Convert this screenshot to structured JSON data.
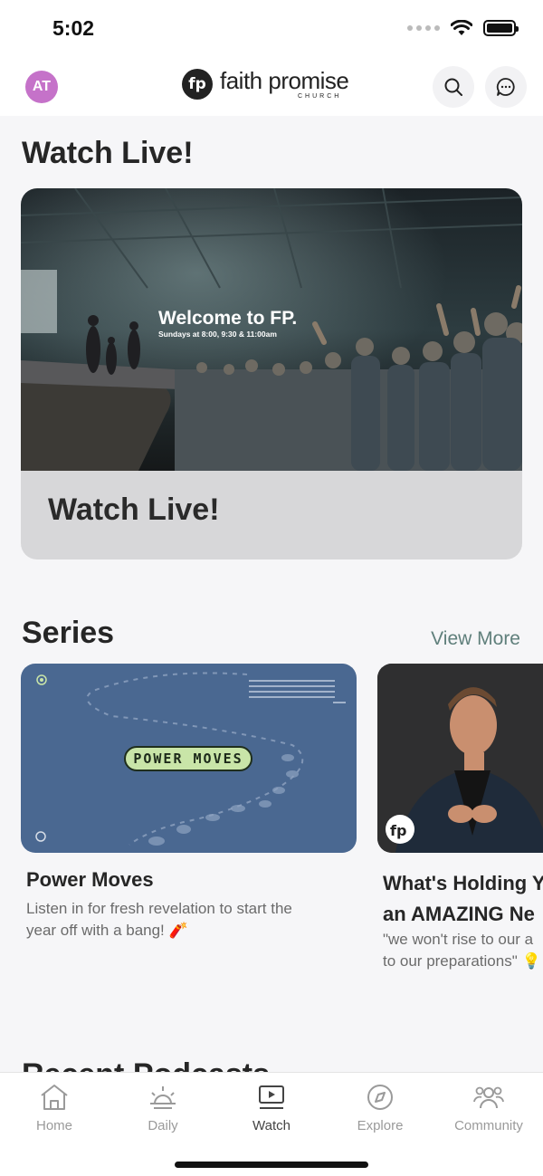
{
  "status_bar": {
    "time": "5:02"
  },
  "header": {
    "avatar_initials": "AT",
    "logo_mark": "fp",
    "logo_name": "faith promise",
    "logo_sub": "CHURCH"
  },
  "watch_live": {
    "section_title": "Watch Live!",
    "card_label": "Watch Live!",
    "image_headline": "Welcome to FP.",
    "image_subline": "Sundays at 8:00, 9:30 & 11:00am"
  },
  "series": {
    "section_title": "Series",
    "view_more_label": "View More",
    "items": [
      {
        "title": "Power Moves",
        "badge": "POWER MOVES",
        "description_line1": "Listen in for fresh revelation to start the",
        "description_line2": "year off with a bang! 🧨"
      },
      {
        "title_line1": "What's Holding Y",
        "title_line2": "an AMAZING Ne",
        "description_line1": "\"we won't rise to our a",
        "description_line2": "to our preparations\" 💡",
        "logo_mark": "fp"
      }
    ]
  },
  "next_section_peek": "Recent Podcasts",
  "tabs": [
    {
      "label": "Home",
      "icon": "home-icon"
    },
    {
      "label": "Daily",
      "icon": "sunrise-icon"
    },
    {
      "label": "Watch",
      "icon": "play-icon",
      "active": true
    },
    {
      "label": "Explore",
      "icon": "compass-icon"
    },
    {
      "label": "Community",
      "icon": "people-icon"
    }
  ],
  "colors": {
    "accent": "#5f7f7b",
    "avatar": "#c572c9",
    "series_card_bg": "#4a6891",
    "badge_bg": "#c9e5a8"
  }
}
